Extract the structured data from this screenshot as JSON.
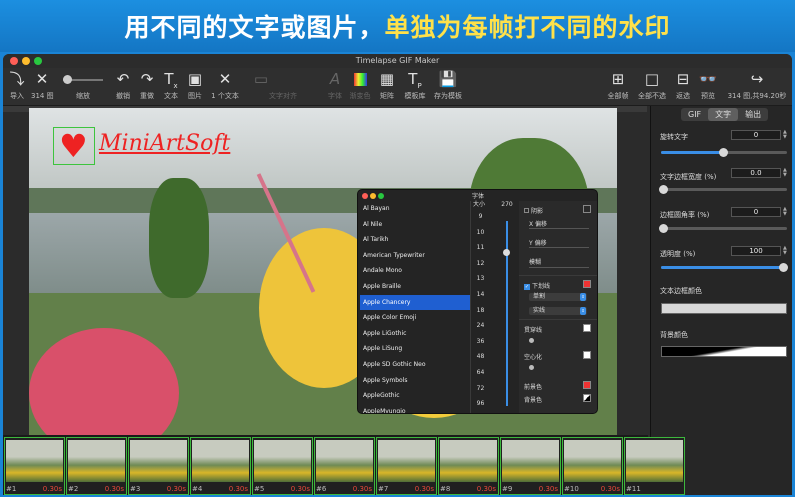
{
  "banner": {
    "part1": "用不同的文字或图片，",
    "part2": "单独为每帧打不同的水印"
  },
  "window": {
    "title": "Timelapse GIF Maker"
  },
  "toolbar": {
    "import": "导入",
    "frame_count": "314 图",
    "zoom": "缩放",
    "undo": "撤销",
    "redo": "重做",
    "text": "文本",
    "image": "图片",
    "one_text": "1 个文本",
    "text_align": "文字对齐",
    "font": "字体",
    "gradient": "渐变色",
    "matrix": "矩阵",
    "template_library": "模板库",
    "save_template": "存为模板",
    "select_all": "全部帧",
    "deselect_all": "全部不选",
    "invert": "返选",
    "preview": "预览",
    "export_info": "314 图,共94.20秒"
  },
  "watermark": {
    "text": "MiniArtSoft"
  },
  "font_panel": {
    "title": "字体",
    "size_header": "大小",
    "size_value": "270",
    "fonts": [
      "Al Bayan",
      "Al Nile",
      "Al Tarikh",
      "American Typewriter",
      "Andale Mono",
      "Apple Braille",
      "Apple Chancery",
      "Apple  Color  Emoji",
      "Apple LiGothic",
      "Apple LiSung",
      "Apple SD Gothic Neo",
      "Apple Symbols",
      "AppleGothic",
      "AppleMyungjo"
    ],
    "selected_index": 6,
    "sizes": [
      "9",
      "10",
      "11",
      "12",
      "13",
      "14",
      "18",
      "24",
      "36",
      "48",
      "64",
      "72",
      "96"
    ],
    "effects": {
      "shadow": "阴影",
      "x_offset": "X 偏移",
      "y_offset": "Y 偏移",
      "blur": "模糊",
      "underline": "下划线",
      "underline_style": "单割",
      "line_style": "实线",
      "strikethrough": "贯穿线",
      "hollow": "空心化",
      "foreground": "前景色",
      "background": "背景色"
    }
  },
  "side_panel": {
    "tabs": [
      "GIF",
      "文字",
      "输出"
    ],
    "active_tab": 1,
    "rotate_label": "旋转文字",
    "rotate_value": "0",
    "border_width_label": "文字边框宽度 (%)",
    "border_width_value": "0.0",
    "corner_label": "边框圆角率 (%)",
    "corner_value": "0",
    "opacity_label": "透明度 (%)",
    "opacity_value": "100",
    "border_color_label": "文本边框颜色",
    "bg_color_label": "背景颜色"
  },
  "filmstrip": {
    "frames": [
      {
        "num": "#1",
        "dur": "0.30s"
      },
      {
        "num": "#2",
        "dur": "0.30s"
      },
      {
        "num": "#3",
        "dur": "0.30s"
      },
      {
        "num": "#4",
        "dur": "0.30s"
      },
      {
        "num": "#5",
        "dur": "0.30s"
      },
      {
        "num": "#6",
        "dur": "0.30s"
      },
      {
        "num": "#7",
        "dur": "0.30s"
      },
      {
        "num": "#8",
        "dur": "0.30s"
      },
      {
        "num": "#9",
        "dur": "0.30s"
      },
      {
        "num": "#10",
        "dur": "0.30s"
      },
      {
        "num": "#11",
        "dur": ""
      }
    ]
  },
  "colors": {
    "accent": "#1f5fd1",
    "frame_border": "#3db83d",
    "watermark": "#ee2222",
    "duration": "#e8473a"
  },
  "icons": [
    "import-icon",
    "close-icon",
    "undo-icon",
    "redo-icon",
    "text-icon",
    "image-icon",
    "grid-icon",
    "square-icon",
    "preview-glasses-icon",
    "export-icon"
  ]
}
